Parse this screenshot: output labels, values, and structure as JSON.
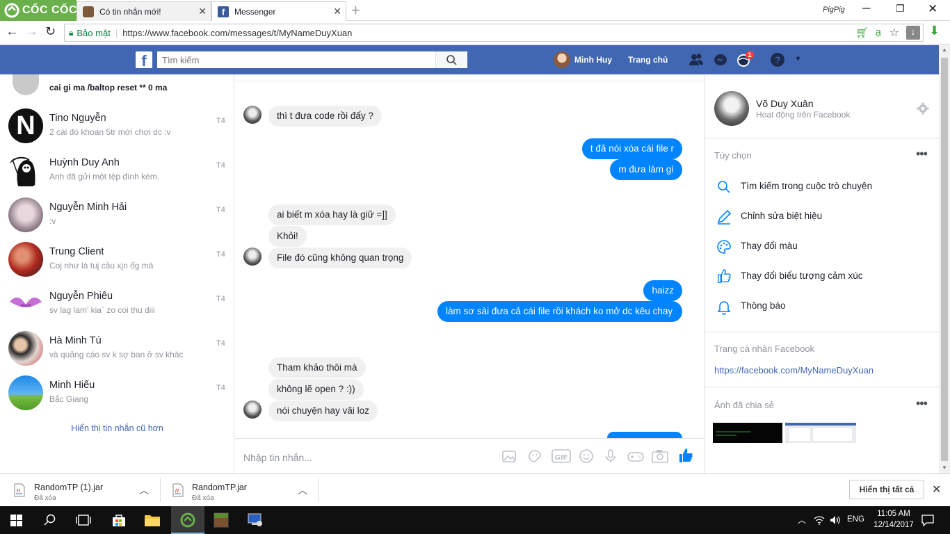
{
  "browser": {
    "logo_text": "CỐC CỐC",
    "tabs": [
      {
        "title": "Có tin nhắn mới!"
      },
      {
        "title": "Messenger"
      }
    ],
    "window_user": "PigPig",
    "secure_label": "Bảo mật",
    "url": "https://www.facebook.com/messages/t/MyNameDuyXuan"
  },
  "fb": {
    "search_placeholder": "Tìm kiếm",
    "user_name": "Minh Huy",
    "home_label": "Trang chủ",
    "notif_count": "1"
  },
  "conversations": {
    "top_partial": "cai gi ma /baltop reset ** 0 ma",
    "items": [
      {
        "name": "Tino Nguyễn",
        "preview": "2 cái đó khoan 5tr mới chơi dc :v",
        "time": "T4"
      },
      {
        "name": "Huỳnh Duy Anh",
        "preview": "Anh đã gửi một tệp đính kèm.",
        "time": "T4"
      },
      {
        "name": "Nguyễn Minh Hải",
        "preview": ":v",
        "time": "T4"
      },
      {
        "name": "Trung Client",
        "preview": "Coj như là tuj cầu xjn ốg mà",
        "time": "T4"
      },
      {
        "name": "Nguyễn Phiêu",
        "preview": "sv lag lam' kia` zo coi thu diii",
        "time": "T4"
      },
      {
        "name": "Hà Minh Tú",
        "preview": "và quảng cáo sv k sợ ban ở sv khác",
        "time": "T4"
      },
      {
        "name": "Minh Hiếu",
        "preview": "Bắc Giang",
        "time": "T4"
      }
    ],
    "older_link": "Hiển thị tin nhắn cũ hơn"
  },
  "messages": [
    {
      "dir": "in",
      "text": "thì t đưa code rồi đấy ?"
    },
    {
      "dir": "out",
      "text": "t đã nói xóa cái file r"
    },
    {
      "dir": "out",
      "text": "m đưa làm gì"
    },
    {
      "dir": "in",
      "text": "ai biết m xóa hay là giữ =]]"
    },
    {
      "dir": "in",
      "text": "Khỏi!"
    },
    {
      "dir": "in",
      "text": "File đó cũng không quan trọng"
    },
    {
      "dir": "out",
      "text": "haizz"
    },
    {
      "dir": "out",
      "text": "làm sơ sài đưa cả cái file rồi khách ko mở dc kêu chay"
    },
    {
      "dir": "in",
      "text": "Tham khảo thôi mà"
    },
    {
      "dir": "in",
      "text": "không lẽ open ? :))"
    },
    {
      "dir": "in",
      "text": "nói chuyện hay vãi loz"
    }
  ],
  "composer": {
    "placeholder": "Nhập tin nhắn..."
  },
  "profile": {
    "name": "Võ Duy Xuân",
    "status": "Hoạt động trên Facebook",
    "options_title": "Tùy chọn",
    "options": [
      {
        "label": "Tìm kiếm trong cuộc trò chuyện",
        "icon": "search-icon"
      },
      {
        "label": "Chỉnh sửa biệt hiệu",
        "icon": "pencil-icon"
      },
      {
        "label": "Thay đổi màu",
        "icon": "palette-icon"
      },
      {
        "label": "Thay đổi biểu tượng cảm xúc",
        "icon": "thumbs-up-icon"
      },
      {
        "label": "Thông báo",
        "icon": "bell-icon"
      }
    ],
    "profile_title": "Trang cá nhân Facebook",
    "profile_link": "https://facebook.com/MyNameDuyXuan",
    "shared_photos_title": "Ảnh đã chia sẻ"
  },
  "downloads": {
    "items": [
      {
        "name": "RandomTP (1).jar",
        "status": "Đã xóa"
      },
      {
        "name": "RandomTP.jar",
        "status": "Đã xóa"
      }
    ],
    "show_all": "Hiển thị tất cả"
  },
  "taskbar": {
    "language": "ENG",
    "time": "11:05 AM",
    "date": "12/14/2017"
  },
  "colors": {
    "fb_blue": "#4267b2",
    "messenger_blue": "#0084ff",
    "coccoc_green": "#6ab04c"
  }
}
